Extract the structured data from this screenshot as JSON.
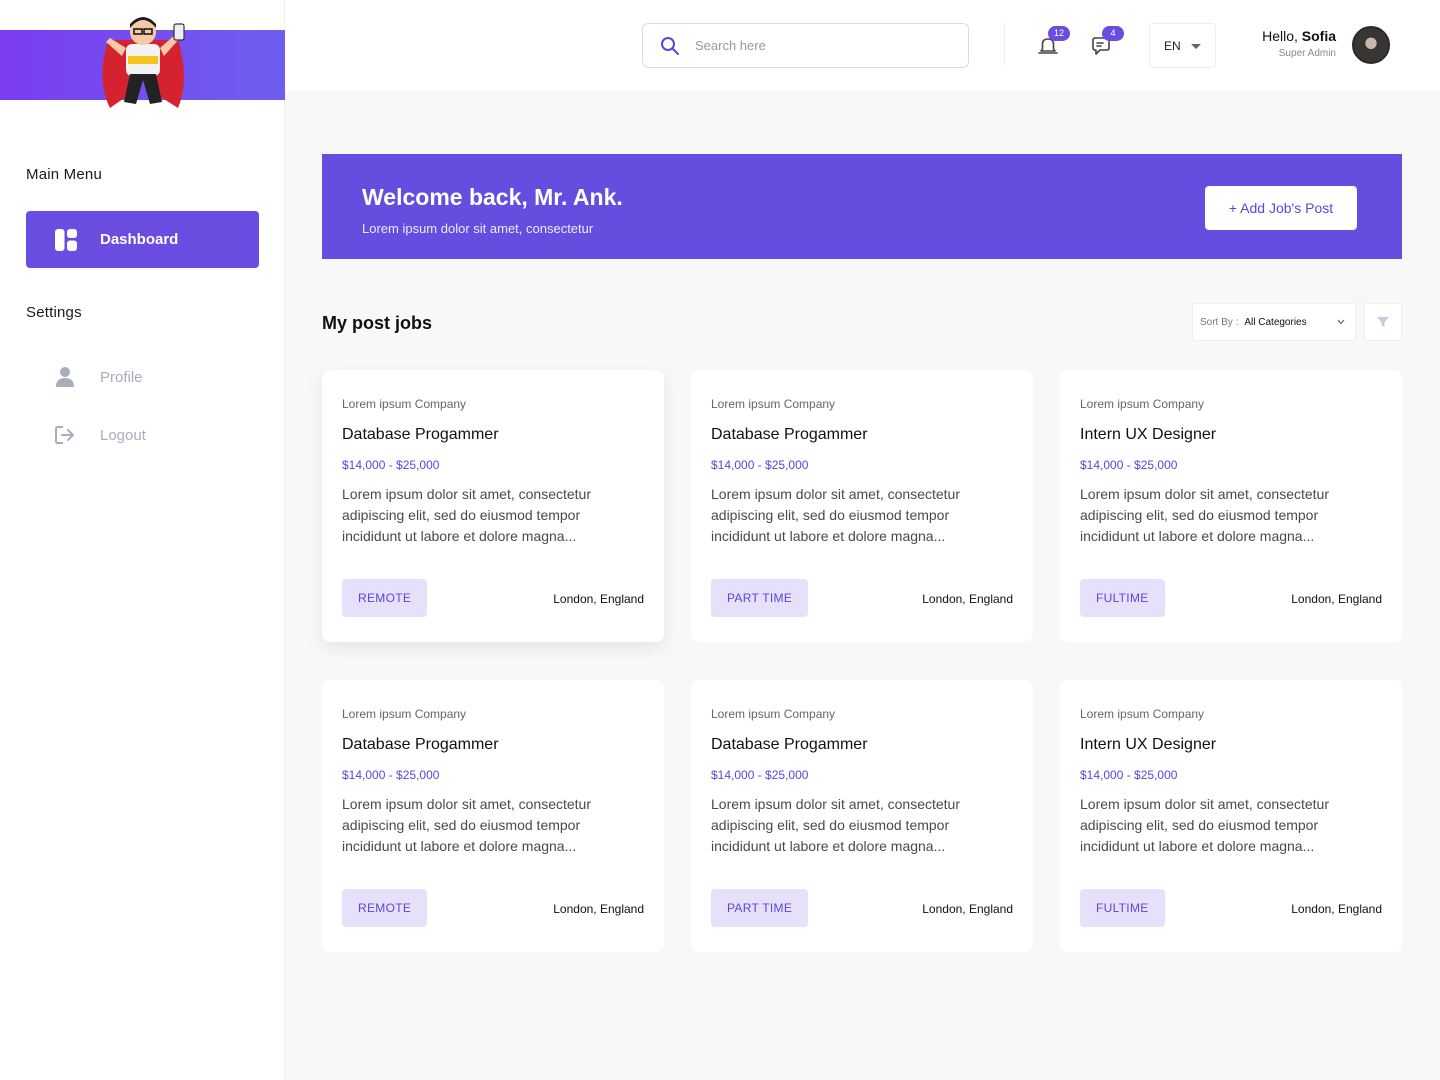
{
  "sidebar": {
    "main_menu_heading": "Main Menu",
    "settings_heading": "Settings",
    "dashboard_label": "Dashboard",
    "profile_label": "Profile",
    "logout_label": "Logout"
  },
  "header": {
    "search_placeholder": "Search here",
    "notifications_count": "12",
    "messages_count": "4",
    "language": "EN",
    "greeting_prefix": "Hello,",
    "user_name": "Sofia",
    "user_role": "Super Admin"
  },
  "banner": {
    "title": "Welcome back, Mr. Ank.",
    "subtitle": "Lorem ipsum dolor sit amet, consectetur",
    "add_button": "+ Add Job's Post"
  },
  "jobs_section": {
    "title": "My post jobs",
    "sort_label": "Sort By :",
    "sort_value": "All Categories"
  },
  "jobs": [
    {
      "company": "Lorem ipsum Company",
      "title": "Database Progammer",
      "salary": "$14,000 - $25,000",
      "description": "Lorem ipsum dolor sit amet, consectetur adipiscing elit, sed do eiusmod tempor incididunt ut labore et dolore magna...",
      "tag": "REMOTE",
      "location": "London, England"
    },
    {
      "company": "Lorem ipsum Company",
      "title": "Database Progammer",
      "salary": "$14,000 - $25,000",
      "description": "Lorem ipsum dolor sit amet, consectetur adipiscing elit, sed do eiusmod tempor incididunt ut labore et dolore magna...",
      "tag": "PART TIME",
      "location": "London, England"
    },
    {
      "company": "Lorem ipsum Company",
      "title": "Intern UX Designer",
      "salary": "$14,000 - $25,000",
      "description": "Lorem ipsum dolor sit amet, consectetur adipiscing elit, sed do eiusmod tempor incididunt ut labore et dolore magna...",
      "tag": "FULTIME",
      "location": "London, England"
    },
    {
      "company": "Lorem ipsum Company",
      "title": "Database Progammer",
      "salary": "$14,000 - $25,000",
      "description": "Lorem ipsum dolor sit amet, consectetur adipiscing elit, sed do eiusmod tempor incididunt ut labore et dolore magna...",
      "tag": "REMOTE",
      "location": "London, England"
    },
    {
      "company": "Lorem ipsum Company",
      "title": "Database Progammer",
      "salary": "$14,000 - $25,000",
      "description": "Lorem ipsum dolor sit amet, consectetur adipiscing elit, sed do eiusmod tempor incididunt ut labore et dolore magna...",
      "tag": "PART TIME",
      "location": "London, England"
    },
    {
      "company": "Lorem ipsum Company",
      "title": "Intern UX Designer",
      "salary": "$14,000 - $25,000",
      "description": "Lorem ipsum dolor sit amet, consectetur adipiscing elit, sed do eiusmod tempor incididunt ut labore et dolore magna...",
      "tag": "FULTIME",
      "location": "London, England"
    }
  ],
  "colors": {
    "accent": "#634ee0",
    "tag_background": "#e6e0fb",
    "page_background": "#f8f8f8"
  },
  "icons": {
    "search": "search-icon",
    "notifications": "bell-icon",
    "messages": "chat-icon",
    "dashboard": "dashboard-icon",
    "profile": "user-icon",
    "logout": "logout-icon",
    "filter": "filter-icon",
    "language_caret": "chevron-down-icon"
  }
}
